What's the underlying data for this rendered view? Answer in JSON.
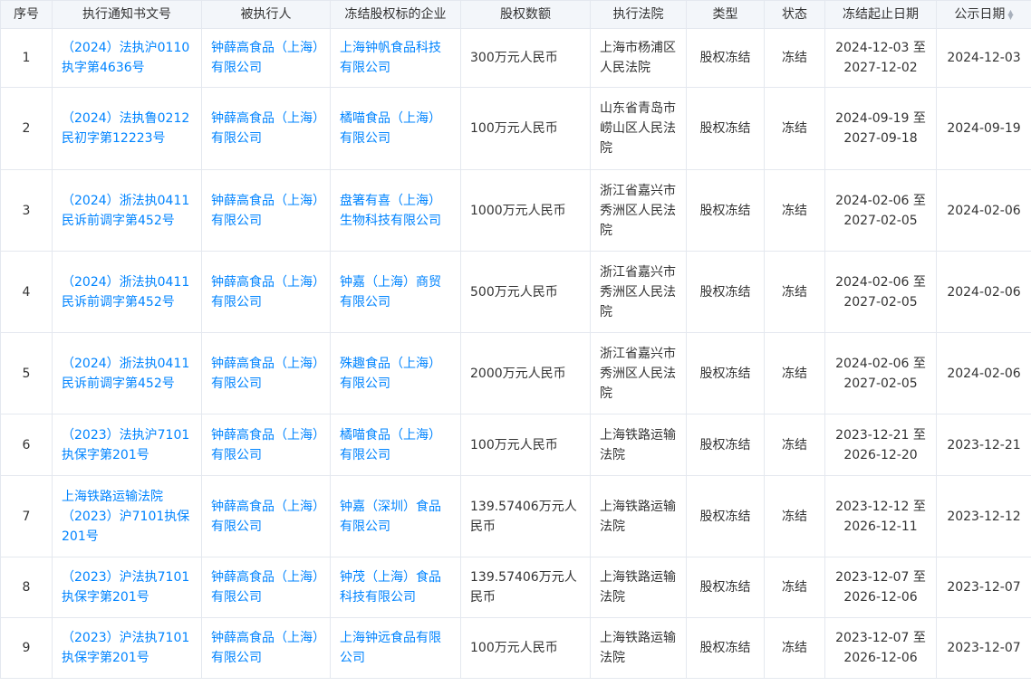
{
  "headers": {
    "index": "序号",
    "notice_no": "执行通知书文号",
    "executee": "被执行人",
    "frozen_company": "冻结股权标的企业",
    "amount": "股权数额",
    "court": "执行法院",
    "type": "类型",
    "status": "状态",
    "period": "冻结起止日期",
    "publish_date": "公示日期"
  },
  "icons": {
    "sort": "sort-icon"
  },
  "colors": {
    "link": "#0084ff",
    "header_bg": "#f3f6fa",
    "border": "#e4e8ef"
  },
  "rows": [
    {
      "index": "1",
      "notice_no": "（2024）法执沪0110执字第4636号",
      "executee": "钟薛高食品（上海）有限公司",
      "frozen_company": "上海钟帆食品科技有限公司",
      "amount": "300万元人民币",
      "court": "上海市杨浦区人民法院",
      "type": "股权冻结",
      "status": "冻结",
      "period": "2024-12-03 至 2027-12-02",
      "publish_date": "2024-12-03"
    },
    {
      "index": "2",
      "notice_no": "（2024）法执鲁0212民初字第12223号",
      "executee": "钟薛高食品（上海）有限公司",
      "frozen_company": "橘喵食品（上海）有限公司",
      "amount": "100万元人民币",
      "court": "山东省青岛市崂山区人民法院",
      "type": "股权冻结",
      "status": "冻结",
      "period": "2024-09-19 至 2027-09-18",
      "publish_date": "2024-09-19"
    },
    {
      "index": "3",
      "notice_no": "（2024）浙法执0411民诉前调字第452号",
      "executee": "钟薛高食品（上海）有限公司",
      "frozen_company": "盘箸有喜（上海）生物科技有限公司",
      "amount": "1000万元人民币",
      "court": "浙江省嘉兴市秀洲区人民法院",
      "type": "股权冻结",
      "status": "冻结",
      "period": "2024-02-06 至 2027-02-05",
      "publish_date": "2024-02-06"
    },
    {
      "index": "4",
      "notice_no": "（2024）浙法执0411民诉前调字第452号",
      "executee": "钟薛高食品（上海）有限公司",
      "frozen_company": "钟嘉（上海）商贸有限公司",
      "amount": "500万元人民币",
      "court": "浙江省嘉兴市秀洲区人民法院",
      "type": "股权冻结",
      "status": "冻结",
      "period": "2024-02-06 至 2027-02-05",
      "publish_date": "2024-02-06"
    },
    {
      "index": "5",
      "notice_no": "（2024）浙法执0411民诉前调字第452号",
      "executee": "钟薛高食品（上海）有限公司",
      "frozen_company": "殊趣食品（上海）有限公司",
      "amount": "2000万元人民币",
      "court": "浙江省嘉兴市秀洲区人民法院",
      "type": "股权冻结",
      "status": "冻结",
      "period": "2024-02-06 至 2027-02-05",
      "publish_date": "2024-02-06"
    },
    {
      "index": "6",
      "notice_no": "（2023）法执沪7101执保字第201号",
      "executee": "钟薛高食品（上海）有限公司",
      "frozen_company": "橘喵食品（上海）有限公司",
      "amount": "100万元人民币",
      "court": "上海铁路运输法院",
      "type": "股权冻结",
      "status": "冻结",
      "period": "2023-12-21 至 2026-12-20",
      "publish_date": "2023-12-21"
    },
    {
      "index": "7",
      "notice_no": "上海铁路运输法院（2023）沪7101执保201号",
      "executee": "钟薛高食品（上海）有限公司",
      "frozen_company": "钟嘉（深圳）食品有限公司",
      "amount": "139.57406万元人民币",
      "court": "上海铁路运输法院",
      "type": "股权冻结",
      "status": "冻结",
      "period": "2023-12-12 至 2026-12-11",
      "publish_date": "2023-12-12"
    },
    {
      "index": "8",
      "notice_no": "（2023）沪法执7101执保字第201号",
      "executee": "钟薛高食品（上海）有限公司",
      "frozen_company": "钟茂（上海）食品科技有限公司",
      "amount": "139.57406万元人民币",
      "court": "上海铁路运输法院",
      "type": "股权冻结",
      "status": "冻结",
      "period": "2023-12-07 至 2026-12-06",
      "publish_date": "2023-12-07"
    },
    {
      "index": "9",
      "notice_no": "（2023）沪法执7101执保字第201号",
      "executee": "钟薛高食品（上海）有限公司",
      "frozen_company": "上海钟远食品有限公司",
      "amount": "100万元人民币",
      "court": "上海铁路运输法院",
      "type": "股权冻结",
      "status": "冻结",
      "period": "2023-12-07 至 2026-12-06",
      "publish_date": "2023-12-07"
    }
  ]
}
